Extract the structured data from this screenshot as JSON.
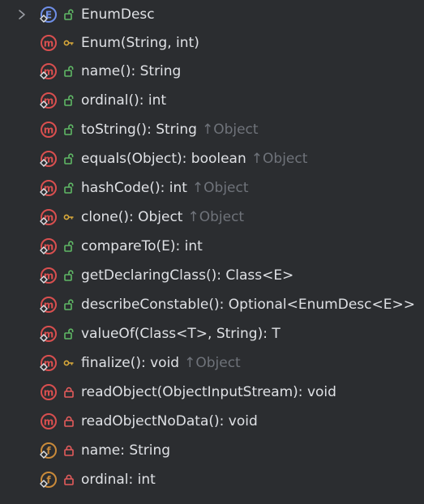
{
  "tree": {
    "root": {
      "label": "EnumDesc",
      "icon": "enum-class-icon",
      "visibility": "public"
    },
    "items": [
      {
        "label": "Enum(String, int)",
        "kind": "method",
        "visibility": "protected",
        "inherited": "",
        "overlay": false
      },
      {
        "label": "name(): String",
        "kind": "method",
        "visibility": "public",
        "inherited": "",
        "overlay": true
      },
      {
        "label": "ordinal(): int",
        "kind": "method",
        "visibility": "public",
        "inherited": "",
        "overlay": true
      },
      {
        "label": "toString(): String",
        "kind": "method",
        "visibility": "public",
        "inherited": "Object",
        "overlay": false
      },
      {
        "label": "equals(Object): boolean",
        "kind": "method",
        "visibility": "public",
        "inherited": "Object",
        "overlay": true
      },
      {
        "label": "hashCode(): int",
        "kind": "method",
        "visibility": "public",
        "inherited": "Object",
        "overlay": true
      },
      {
        "label": "clone(): Object",
        "kind": "method",
        "visibility": "protected",
        "inherited": "Object",
        "overlay": true
      },
      {
        "label": "compareTo(E): int",
        "kind": "method",
        "visibility": "public",
        "inherited": "",
        "overlay": true
      },
      {
        "label": "getDeclaringClass(): Class<E>",
        "kind": "method",
        "visibility": "public",
        "inherited": "",
        "overlay": true
      },
      {
        "label": "describeConstable(): Optional<EnumDesc<E>>",
        "kind": "method",
        "visibility": "public",
        "inherited": "",
        "overlay": true
      },
      {
        "label": "valueOf(Class<T>, String): T",
        "kind": "method",
        "visibility": "public",
        "inherited": "",
        "overlay": true
      },
      {
        "label": "finalize(): void",
        "kind": "method",
        "visibility": "protected",
        "inherited": "Object",
        "overlay": true
      },
      {
        "label": "readObject(ObjectInputStream): void",
        "kind": "method",
        "visibility": "private",
        "inherited": "",
        "overlay": false
      },
      {
        "label": "readObjectNoData(): void",
        "kind": "method",
        "visibility": "private",
        "inherited": "",
        "overlay": false
      },
      {
        "label": "name: String",
        "kind": "field",
        "visibility": "private",
        "inherited": "",
        "overlay": true
      },
      {
        "label": "ordinal: int",
        "kind": "field",
        "visibility": "private",
        "inherited": "",
        "overlay": true
      }
    ],
    "inherit_arrow": "↑"
  },
  "colors": {
    "background": "#2b2d30",
    "text": "#dfe1e5",
    "inherited_text": "#6f737a",
    "method_badge": "#d94f4f",
    "field_badge": "#c98a3a",
    "enum_badge": "#6f8fe8",
    "public_lock": "#5fb865",
    "protected_key": "#d9a93a",
    "private_lock": "#e55b5b"
  }
}
